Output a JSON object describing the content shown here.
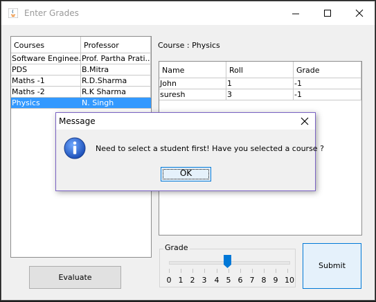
{
  "window": {
    "title": "Enter Grades"
  },
  "courses_table": {
    "columns": [
      "Courses",
      "Professor"
    ],
    "rows": [
      [
        "Software Enginee...",
        "Prof. Partha Prati..."
      ],
      [
        "PDS",
        "B.Mitra"
      ],
      [
        "Maths -1",
        "R.D.Sharma"
      ],
      [
        "Maths -2",
        "R.K Sharma"
      ],
      [
        "Physics",
        "N. Singh"
      ]
    ],
    "selected_index": 4
  },
  "course_label": "Course : Physics",
  "students_table": {
    "columns": [
      "Name",
      "Roll",
      "Grade"
    ],
    "rows": [
      [
        "John",
        "1",
        "-1"
      ],
      [
        "suresh",
        "3",
        "-1"
      ]
    ]
  },
  "buttons": {
    "evaluate": "Evaluate",
    "submit": "Submit"
  },
  "grade_slider": {
    "label": "Grade",
    "min": 0,
    "max": 10,
    "value": 5,
    "ticks": [
      "0",
      "1",
      "2",
      "3",
      "4",
      "5",
      "6",
      "7",
      "8",
      "9",
      "10"
    ]
  },
  "dialog": {
    "title": "Message",
    "message": "Need to select a student first! Have you selected a course ?",
    "ok_label": "OK",
    "icon": "info-icon"
  },
  "colors": {
    "selection": "#3399ff",
    "accent": "#0078d7",
    "dialog_border": "#7a62c4",
    "slider_thumb": "#0078d7"
  }
}
